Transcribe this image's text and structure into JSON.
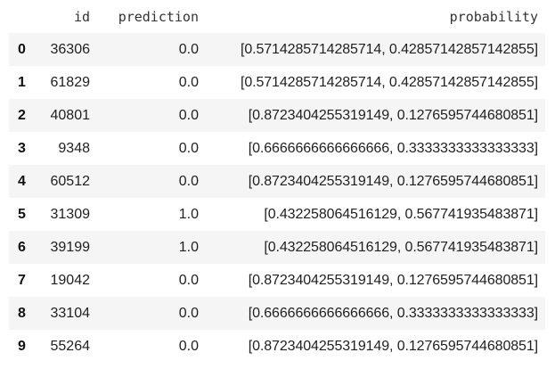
{
  "table": {
    "columns": [
      "",
      "id",
      "prediction",
      "probability"
    ],
    "rows": [
      {
        "index": "0",
        "id": "36306",
        "prediction": "0.0",
        "probability": "[0.5714285714285714, 0.42857142857142855]"
      },
      {
        "index": "1",
        "id": "61829",
        "prediction": "0.0",
        "probability": "[0.5714285714285714, 0.42857142857142855]"
      },
      {
        "index": "2",
        "id": "40801",
        "prediction": "0.0",
        "probability": "[0.8723404255319149, 0.1276595744680851]"
      },
      {
        "index": "3",
        "id": "9348",
        "prediction": "0.0",
        "probability": "[0.6666666666666666, 0.3333333333333333]"
      },
      {
        "index": "4",
        "id": "60512",
        "prediction": "0.0",
        "probability": "[0.8723404255319149, 0.1276595744680851]"
      },
      {
        "index": "5",
        "id": "31309",
        "prediction": "1.0",
        "probability": "[0.432258064516129, 0.567741935483871]"
      },
      {
        "index": "6",
        "id": "39199",
        "prediction": "1.0",
        "probability": "[0.432258064516129, 0.567741935483871]"
      },
      {
        "index": "7",
        "id": "19042",
        "prediction": "0.0",
        "probability": "[0.8723404255319149, 0.1276595744680851]"
      },
      {
        "index": "8",
        "id": "33104",
        "prediction": "0.0",
        "probability": "[0.6666666666666666, 0.3333333333333333]"
      },
      {
        "index": "9",
        "id": "55264",
        "prediction": "0.0",
        "probability": "[0.8723404255319149, 0.1276595744680851]"
      }
    ]
  },
  "colors": {
    "stripe": "#f5f5f5",
    "background": "#ffffff",
    "text": "#212121"
  }
}
